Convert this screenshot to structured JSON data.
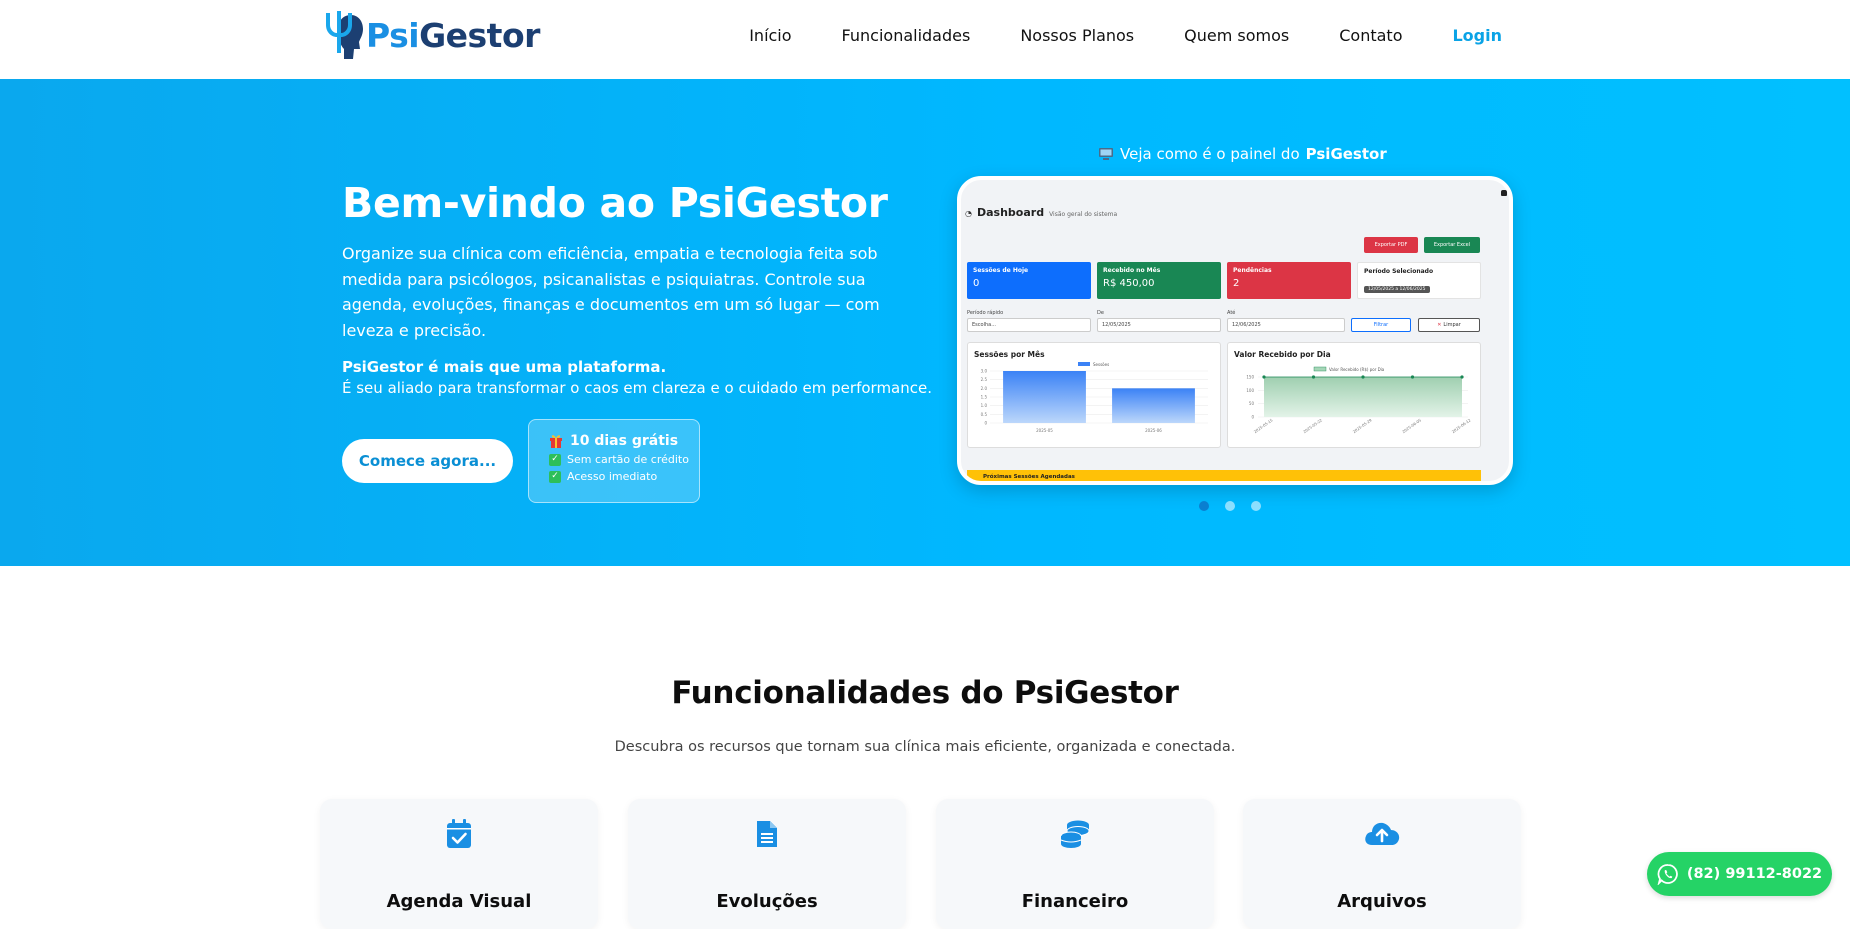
{
  "brand": {
    "name_part1": "Psi",
    "name_part2": "Gestor"
  },
  "nav": {
    "items": [
      "Início",
      "Funcionalidades",
      "Nossos Planos",
      "Quem somos",
      "Contato"
    ],
    "login": "Login"
  },
  "hero": {
    "title": "Bem-vindo ao PsiGestor",
    "description": "Organize sua clínica com eficiência, empatia e tecnologia feita sob medida para psicólogos, psicanalistas e psiquiatras. Controle sua agenda, evoluções, finanças e documentos em um só lugar — com leveza e precisão.",
    "tagline_strong": "PsiGestor é mais que uma plataforma.",
    "tagline": "É seu aliado para transformar o caos em clareza e o cuidado em performance.",
    "cta": "Comece agora...",
    "trial": {
      "title": "10 dias grátis",
      "items": [
        "Sem cartão de crédito",
        "Acesso imediato"
      ]
    },
    "panel_caption_prefix": "Veja como é o painel do",
    "panel_caption_brand": "PsiGestor",
    "carousel": {
      "slides": 3,
      "active": 1
    }
  },
  "dashboard": {
    "title": "Dashboard",
    "subtitle": "Visão geral do sistema",
    "export_pdf": "Exportar PDF",
    "export_excel": "Exportar Excel",
    "kpis": [
      {
        "label": "Sessões de Hoje",
        "value": "0"
      },
      {
        "label": "Recebido no Mês",
        "value": "R$ 450,00"
      },
      {
        "label": "Pendências",
        "value": "2"
      },
      {
        "label": "Período Selecionado",
        "value": "12/05/2025 a 12/06/2025"
      }
    ],
    "filters": {
      "quick_label": "Período rápido",
      "quick_value": "Escolha...",
      "from_label": "De",
      "from_value": "12/05/2025",
      "to_label": "Até",
      "to_value": "12/06/2025",
      "filter_btn": "Filtrar",
      "clear_btn": "Limpar"
    },
    "chart1_title": "Sessões por Mês",
    "chart2_title": "Valor Recebido por Dia",
    "schedule_label": "Próximas Sessões Agendadas"
  },
  "chart_data": [
    {
      "type": "bar",
      "title": "Sessões por Mês",
      "categories": [
        "2025-05",
        "2025-06"
      ],
      "series": [
        {
          "name": "Sessões",
          "values": [
            3,
            2
          ]
        }
      ],
      "ylim": [
        0,
        3
      ],
      "yticks": [
        "0",
        "0.5",
        "1.0",
        "1.5",
        "2.0",
        "2.5",
        "3.0"
      ]
    },
    {
      "type": "area",
      "title": "Valor Recebido por Dia",
      "categories": [
        "2025-05-15",
        "2025-05-22",
        "2025-05-29",
        "2025-06-05",
        "2025-06-12"
      ],
      "series": [
        {
          "name": "Valor Recebido (R$) por Dia",
          "values": [
            150,
            150,
            150,
            150,
            150
          ]
        }
      ],
      "ylim": [
        0,
        150
      ],
      "yticks": [
        "0",
        "50",
        "100",
        "150"
      ]
    }
  ],
  "features": {
    "title": "Funcionalidades do PsiGestor",
    "subtitle": "Descubra os recursos que tornam sua clínica mais eficiente, organizada e conectada.",
    "cards": [
      {
        "name": "Agenda Visual",
        "icon": "calendar-check-icon"
      },
      {
        "name": "Evoluções",
        "icon": "file-text-icon"
      },
      {
        "name": "Financeiro",
        "icon": "coins-icon"
      },
      {
        "name": "Arquivos",
        "icon": "cloud-upload-icon"
      }
    ]
  },
  "whatsapp": {
    "phone": "(82) 99112-8022"
  },
  "colors": {
    "accent": "#00b8ff",
    "brand_blue": "#1a8fe3",
    "brand_navy": "#1c3f72",
    "whatsapp": "#25d366"
  }
}
